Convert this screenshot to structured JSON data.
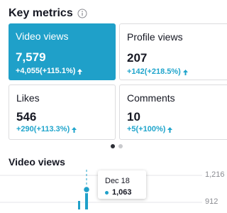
{
  "header": {
    "title": "Key metrics",
    "info_icon": "info-icon"
  },
  "cards": [
    {
      "label": "Video views",
      "value": "7,579",
      "delta": "+4,055(+115.1%)",
      "selected": true
    },
    {
      "label": "Profile views",
      "value": "207",
      "delta": "+142(+218.5%)",
      "selected": false
    },
    {
      "label": "Likes",
      "value": "546",
      "delta": "+290(+113.3%)",
      "selected": false
    },
    {
      "label": "Comments",
      "value": "10",
      "delta": "+5(+100%)",
      "selected": false
    }
  ],
  "pagination": {
    "current_page": 1,
    "total_pages": 2
  },
  "chart": {
    "title": "Video views",
    "y_ticks": [
      "1,216",
      "912"
    ],
    "tooltip": {
      "date": "Dec 18",
      "value": "1,063"
    }
  },
  "colors": {
    "accent": "#1fa0c9",
    "delta_text": "#20a5cc",
    "text": "#161823",
    "muted": "#8a8b91"
  }
}
